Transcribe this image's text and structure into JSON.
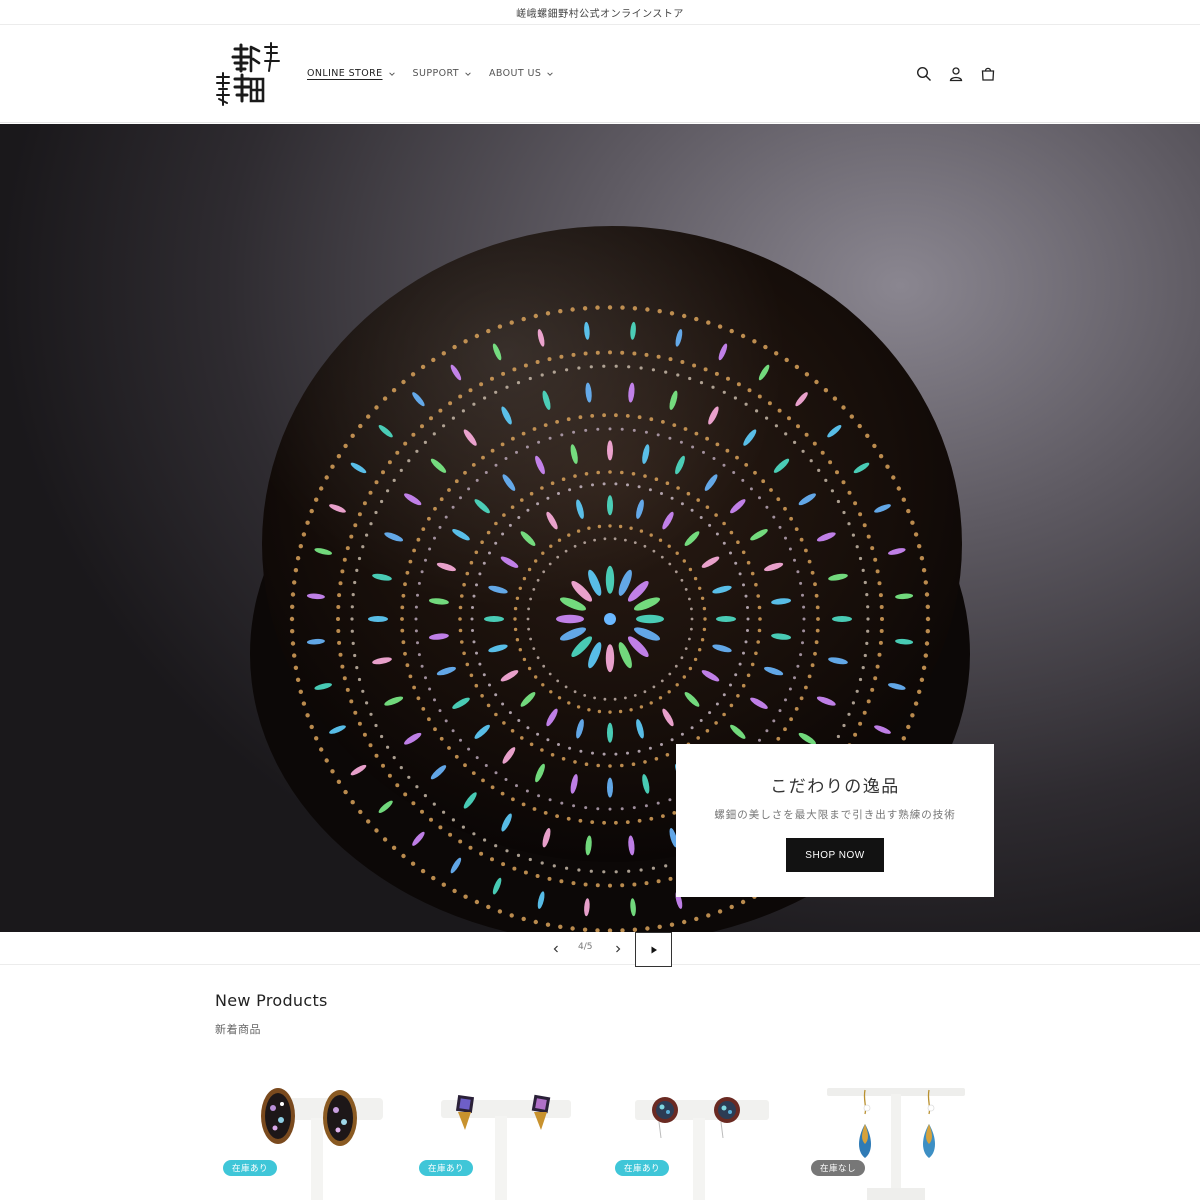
{
  "announcement": "嵯峨螺鈿野村公式オンラインストア",
  "header": {
    "logo_alt": "嵯峨 螺鈿 野村",
    "nav": [
      {
        "label": "ONLINE STORE"
      },
      {
        "label": "SUPPORT"
      },
      {
        "label": "ABOUT US"
      }
    ],
    "icons": [
      "search-icon",
      "account-icon",
      "cart-icon"
    ]
  },
  "hero": {
    "title": "こだわりの逸品",
    "subtitle": "螺鈿の美しさを最大限まで引き出す熟練の技術",
    "button": "SHOP NOW"
  },
  "slider": {
    "counter": "4/5"
  },
  "new_products": {
    "title": "New Products",
    "subtitle": "新着商品",
    "items": [
      {
        "badge": "在庫あり",
        "stock": "in"
      },
      {
        "badge": "在庫あり",
        "stock": "in"
      },
      {
        "badge": "在庫あり",
        "stock": "in"
      },
      {
        "badge": "在庫なし",
        "stock": "out"
      }
    ]
  },
  "colors": {
    "accent_dark": "#121212",
    "badge_in_stock": "#3fc6d8",
    "badge_out_of_stock": "#777777"
  }
}
